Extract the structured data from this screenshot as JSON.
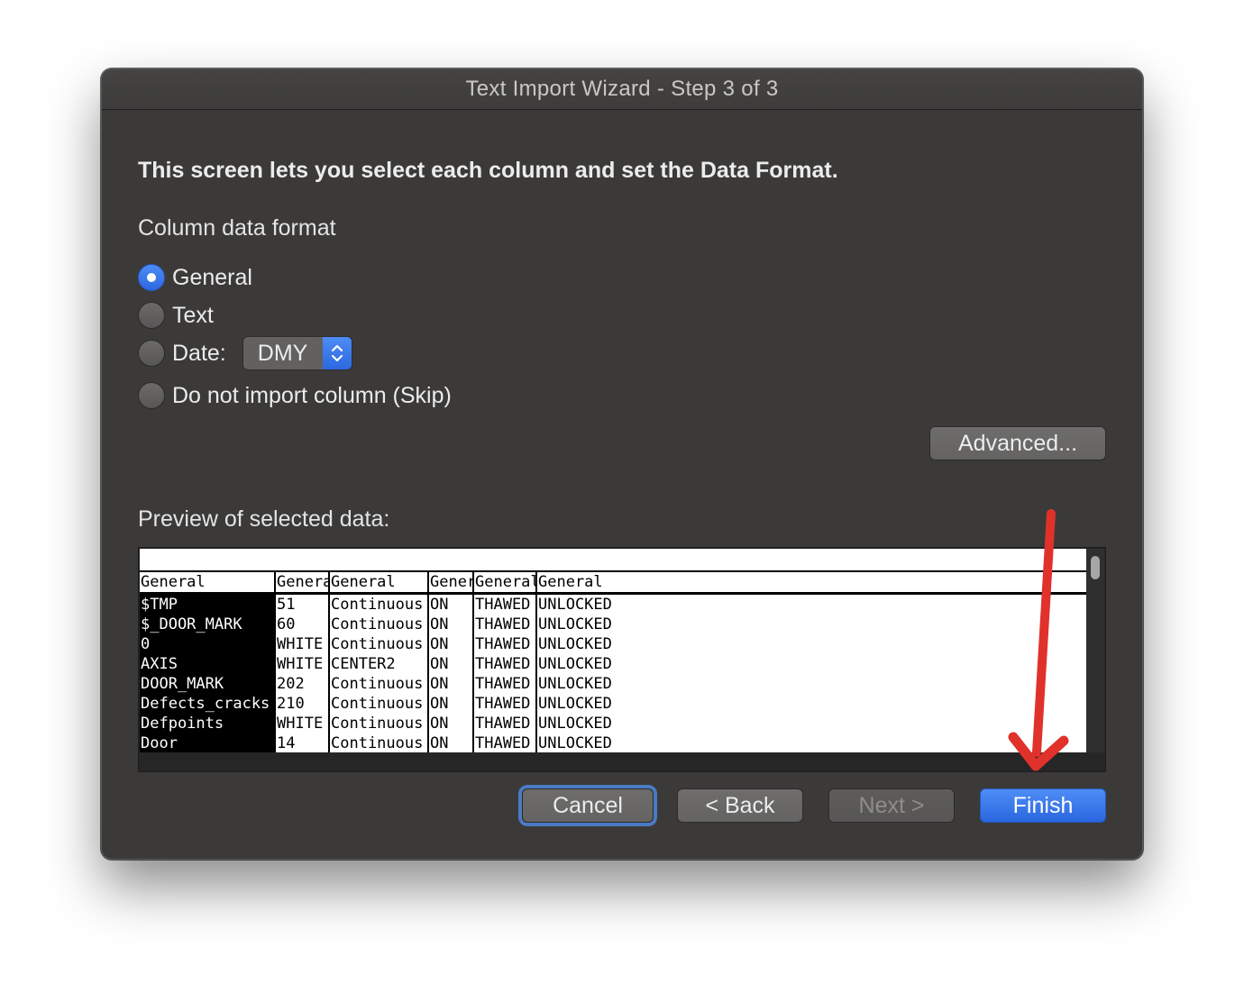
{
  "window": {
    "title": "Text Import Wizard - Step 3 of 3"
  },
  "intro": "This screen lets you select each column and set the Data Format.",
  "column_format": {
    "label": "Column data format",
    "options": [
      {
        "label": "General",
        "checked": true
      },
      {
        "label": "Text",
        "checked": false
      },
      {
        "label": "Date:",
        "checked": false
      },
      {
        "label": "Do not import column (Skip)",
        "checked": false
      }
    ],
    "date_select_value": "DMY"
  },
  "advanced_label": "Advanced...",
  "preview": {
    "label": "Preview of selected data:",
    "headers": [
      "General",
      "General",
      "General",
      "General",
      "General",
      "General"
    ],
    "rows": [
      [
        "$TMP",
        "51",
        "Continuous",
        "ON",
        "THAWED",
        "UNLOCKED"
      ],
      [
        "$_DOOR_MARK",
        "60",
        "Continuous",
        "ON",
        "THAWED",
        "UNLOCKED"
      ],
      [
        "0",
        "WHITE",
        "Continuous",
        "ON",
        "THAWED",
        "UNLOCKED"
      ],
      [
        "AXIS",
        "WHITE",
        "CENTER2",
        "ON",
        "THAWED",
        "UNLOCKED"
      ],
      [
        "DOOR_MARK",
        "202",
        "Continuous",
        "ON",
        "THAWED",
        "UNLOCKED"
      ],
      [
        "Defects_cracks",
        "210",
        "Continuous",
        "ON",
        "THAWED",
        "UNLOCKED"
      ],
      [
        "Defpoints",
        "WHITE",
        "Continuous",
        "ON",
        "THAWED",
        "UNLOCKED"
      ],
      [
        "Door",
        "14",
        "Continuous",
        "ON",
        "THAWED",
        "UNLOCKED"
      ]
    ]
  },
  "buttons": {
    "cancel": "Cancel",
    "back": "< Back",
    "next": "Next >",
    "finish": "Finish"
  },
  "colors": {
    "window_bg": "#3b3a39",
    "accent_blue": "#2d68e0",
    "annotation_arrow": "#e0312b"
  },
  "icons": {
    "select_stepper": "chevron-up-down-icon",
    "annotation": "red-arrow-icon"
  }
}
